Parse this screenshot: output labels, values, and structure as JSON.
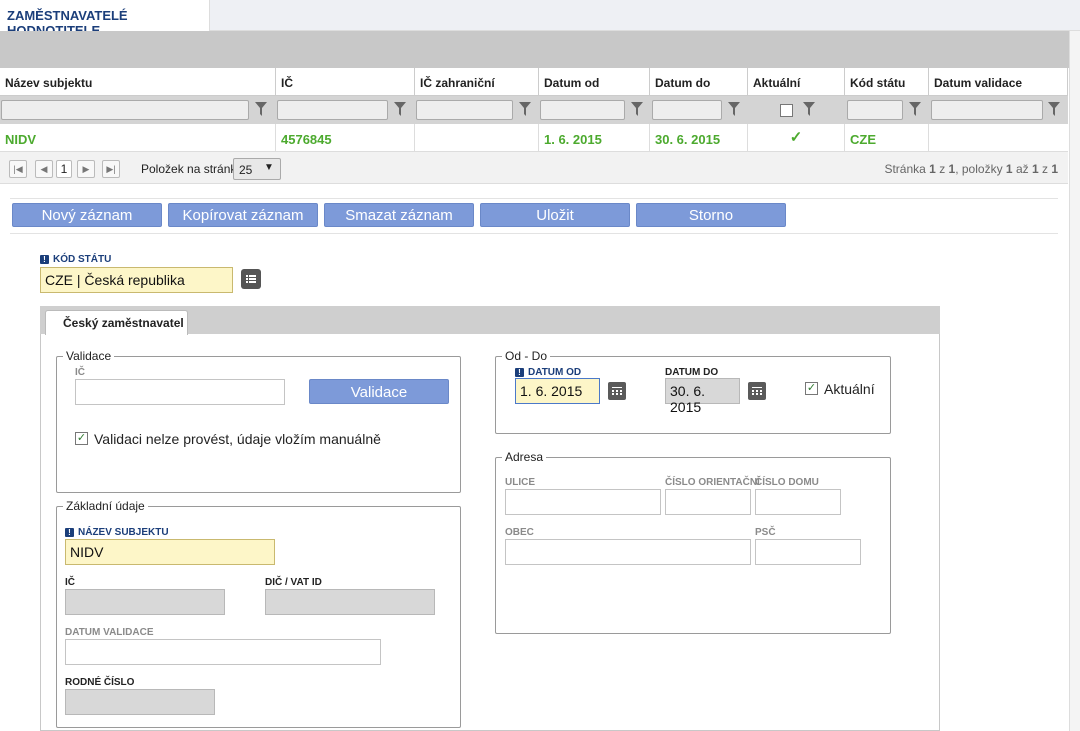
{
  "top_tab": {
    "label": "ZAMĚSTNAVATELÉ HODNOTITELE"
  },
  "grid": {
    "columns": [
      "Název subjektu",
      "IČ",
      "IČ zahraniční",
      "Datum od",
      "Datum do",
      "Aktuální",
      "Kód státu",
      "Datum validace"
    ],
    "row": {
      "nazev": "NIDV",
      "ic": "4576845",
      "ic_zahranicni": "",
      "datum_od": "1. 6. 2015",
      "datum_do": "30. 6. 2015",
      "aktualni": "✓",
      "kod_statu": "CZE",
      "datum_validace": ""
    }
  },
  "pager": {
    "current_page": "1",
    "per_page_label": "Položek na stránku",
    "per_page_value": "25",
    "info_prefix": "Stránka ",
    "info_page": "1",
    "info_of": " z ",
    "info_total_pages": "1",
    "info_items": ", položky ",
    "info_from": "1",
    "info_to_label": " až ",
    "info_to": "1",
    "info_z2": " z ",
    "info_count": "1"
  },
  "toolbar": {
    "new": "Nový záznam",
    "copy": "Kopírovat záznam",
    "delete": "Smazat záznam",
    "save": "Uložit",
    "cancel": "Storno"
  },
  "kod_statu": {
    "label": "KÓD STÁTU",
    "value": "CZE | Česká republika"
  },
  "panel_tab": "Český zaměstnavatel",
  "validace": {
    "legend": "Validace",
    "ic_label": "IČ",
    "ic_value": "",
    "button": "Validace",
    "manual_check_label": "Validaci nelze provést, údaje vložím manuálně",
    "manual_checked": "✓"
  },
  "zakladni": {
    "legend": "Základní údaje",
    "nazev_label": "NÁZEV SUBJEKTU",
    "nazev_value": "NIDV",
    "ic_label": "IČ",
    "dic_label": "DIČ / VAT ID",
    "datum_validace_label": "DATUM VALIDACE",
    "rodne_cislo_label": "RODNÉ ČÍSLO"
  },
  "od_do": {
    "legend": "Od - Do",
    "od_label": "DATUM OD",
    "od_value": "1. 6. 2015",
    "do_label": "DATUM DO",
    "do_value": "30. 6. 2015",
    "aktualni_label": "Aktuální",
    "aktualni_checked": "✓"
  },
  "adresa": {
    "legend": "Adresa",
    "ulice_label": "ULICE",
    "cislo_orientacni_label": "ČÍSLO ORIENTAČNÍ",
    "cislo_domu_label": "ČÍSLO DOMU",
    "obec_label": "OBEC",
    "psc_label": "PSČ"
  },
  "colors": {
    "accent": "#1b3e7a",
    "button": "#7d9ad9",
    "green": "#4caa2e",
    "required_bg": "#fdf6c8"
  }
}
